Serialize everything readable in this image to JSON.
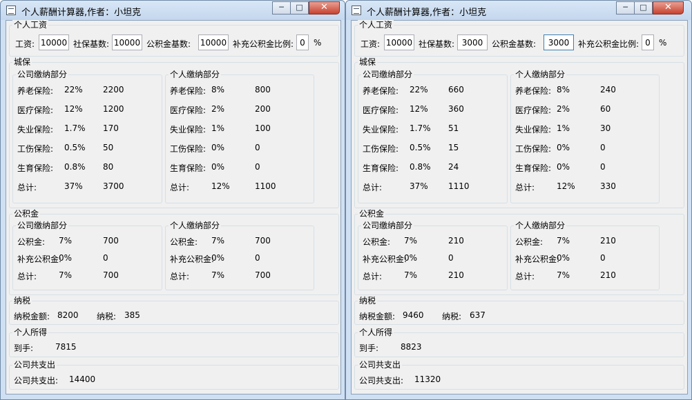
{
  "labels": {
    "personal_salary": "个人工资",
    "salary": "工资:",
    "social_base": "社保基数:",
    "fund_base": "公积金基数:",
    "supp_ratio": "补充公积金比例:",
    "percent": "%",
    "social_security": "城保",
    "company_part": "公司缴纳部分",
    "personal_part": "个人缴纳部分",
    "pension": "养老保险:",
    "medical": "医疗保险:",
    "unemployment": "失业保险:",
    "injury": "工伤保险:",
    "maternity": "生育保险:",
    "total": "总计:",
    "housing_fund": "公积金",
    "fund": "公积金:",
    "supp_fund": "补充公积金:",
    "tax": "纳税",
    "taxable_amount": "纳税金额:",
    "tax_paid": "纳税:",
    "personal_income": "个人所得",
    "net": "到手:",
    "company_expense": "公司共支出",
    "company_total": "公司共支出:"
  },
  "windows": [
    {
      "title": "个人薪酬计算器,作者：小坦克",
      "inputs": {
        "salary": "10000",
        "social_base": "10000",
        "fund_base": "10000",
        "supp_ratio": "0"
      },
      "company": {
        "pension": {
          "rate": "22%",
          "amount": "2200"
        },
        "medical": {
          "rate": "12%",
          "amount": "1200"
        },
        "unemployment": {
          "rate": "1.7%",
          "amount": "170"
        },
        "injury": {
          "rate": "0.5%",
          "amount": "50"
        },
        "maternity": {
          "rate": "0.8%",
          "amount": "80"
        },
        "total": {
          "rate": "37%",
          "amount": "3700"
        }
      },
      "personal": {
        "pension": {
          "rate": "8%",
          "amount": "800"
        },
        "medical": {
          "rate": "2%",
          "amount": "200"
        },
        "unemployment": {
          "rate": "1%",
          "amount": "100"
        },
        "injury": {
          "rate": "0%",
          "amount": "0"
        },
        "maternity": {
          "rate": "0%",
          "amount": "0"
        },
        "total": {
          "rate": "12%",
          "amount": "1100"
        }
      },
      "fund_company": {
        "fund": {
          "rate": "7%",
          "amount": "700"
        },
        "supp": {
          "rate": "0%",
          "amount": "0"
        },
        "total": {
          "rate": "7%",
          "amount": "700"
        }
      },
      "fund_personal": {
        "fund": {
          "rate": "7%",
          "amount": "700"
        },
        "supp": {
          "rate": "0%",
          "amount": "0"
        },
        "total": {
          "rate": "7%",
          "amount": "700"
        }
      },
      "tax": {
        "taxable": "8200",
        "paid": "385"
      },
      "net": "7815",
      "company_total": "14400"
    },
    {
      "title": "个人薪酬计算器,作者：小坦克",
      "inputs": {
        "salary": "10000",
        "social_base": "3000",
        "fund_base": "3000",
        "supp_ratio": "0"
      },
      "company": {
        "pension": {
          "rate": "22%",
          "amount": "660"
        },
        "medical": {
          "rate": "12%",
          "amount": "360"
        },
        "unemployment": {
          "rate": "1.7%",
          "amount": "51"
        },
        "injury": {
          "rate": "0.5%",
          "amount": "15"
        },
        "maternity": {
          "rate": "0.8%",
          "amount": "24"
        },
        "total": {
          "rate": "37%",
          "amount": "1110"
        }
      },
      "personal": {
        "pension": {
          "rate": "8%",
          "amount": "240"
        },
        "medical": {
          "rate": "2%",
          "amount": "60"
        },
        "unemployment": {
          "rate": "1%",
          "amount": "30"
        },
        "injury": {
          "rate": "0%",
          "amount": "0"
        },
        "maternity": {
          "rate": "0%",
          "amount": "0"
        },
        "total": {
          "rate": "12%",
          "amount": "330"
        }
      },
      "fund_company": {
        "fund": {
          "rate": "7%",
          "amount": "210"
        },
        "supp": {
          "rate": "0%",
          "amount": "0"
        },
        "total": {
          "rate": "7%",
          "amount": "210"
        }
      },
      "fund_personal": {
        "fund": {
          "rate": "7%",
          "amount": "210"
        },
        "supp": {
          "rate": "0%",
          "amount": "0"
        },
        "total": {
          "rate": "7%",
          "amount": "210"
        }
      },
      "tax": {
        "taxable": "9460",
        "paid": "637"
      },
      "net": "8823",
      "company_total": "11320"
    }
  ]
}
